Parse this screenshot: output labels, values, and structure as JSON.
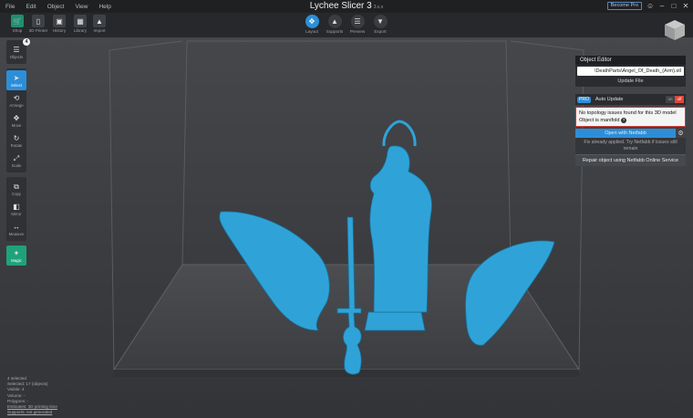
{
  "window": {
    "menu": [
      "File",
      "Edit",
      "Object",
      "View",
      "Help"
    ],
    "title": "Lychee Slicer 3",
    "version": "3.x.x",
    "pro_button": "Become Pro",
    "user_icon": "user-icon"
  },
  "toolbar": {
    "left": [
      {
        "label": "Shop",
        "icon": "cart-icon"
      },
      {
        "label": "3D Printer",
        "icon": "printer-icon"
      },
      {
        "label": "History",
        "icon": "history-icon"
      },
      {
        "label": "Library",
        "icon": "library-icon"
      },
      {
        "label": "Import",
        "icon": "import-icon"
      }
    ],
    "modes": [
      {
        "label": "Layout",
        "active": true
      },
      {
        "label": "Supports",
        "active": false
      },
      {
        "label": "Preview",
        "active": false
      },
      {
        "label": "Export",
        "active": false
      }
    ]
  },
  "sidebar": {
    "objects_label": "Objects",
    "objects_count": "4",
    "tools_group1": [
      "Select",
      "Arrange",
      "Move",
      "Rotate",
      "Scale"
    ],
    "tools_group2": [
      "Copy",
      "Mirror",
      "Measure"
    ],
    "magic_label": "Magic"
  },
  "object_editor": {
    "title": "Object Editor",
    "filename": "\\DeathParts\\Angel_Of_Death_(Arm).stl",
    "update_file": "Update File",
    "pro_tag": "PRO",
    "auto_update": "Auto Update",
    "toggle_on": "on",
    "toggle_off": "off",
    "issue_line1": "No topology issues found for this 3D model",
    "issue_line2": "Object is manifold",
    "open_netfabb": "Open with Netfabb",
    "fix_note": "Fix already applied. Try Netfabb if issues still remain",
    "repair_button": "Repair object using Netfabb Online Service"
  },
  "stats": [
    "4 selected",
    "Selected: 17 (objects)",
    "Visible: 4",
    "Volume: -",
    "Polygons: -",
    "Estimates: 3D printing time",
    "Supports: not generated"
  ],
  "colors": {
    "accent": "#2d8ed8",
    "model": "#2fa3d8",
    "warning": "#d23a32",
    "magic": "#1fa27a"
  }
}
